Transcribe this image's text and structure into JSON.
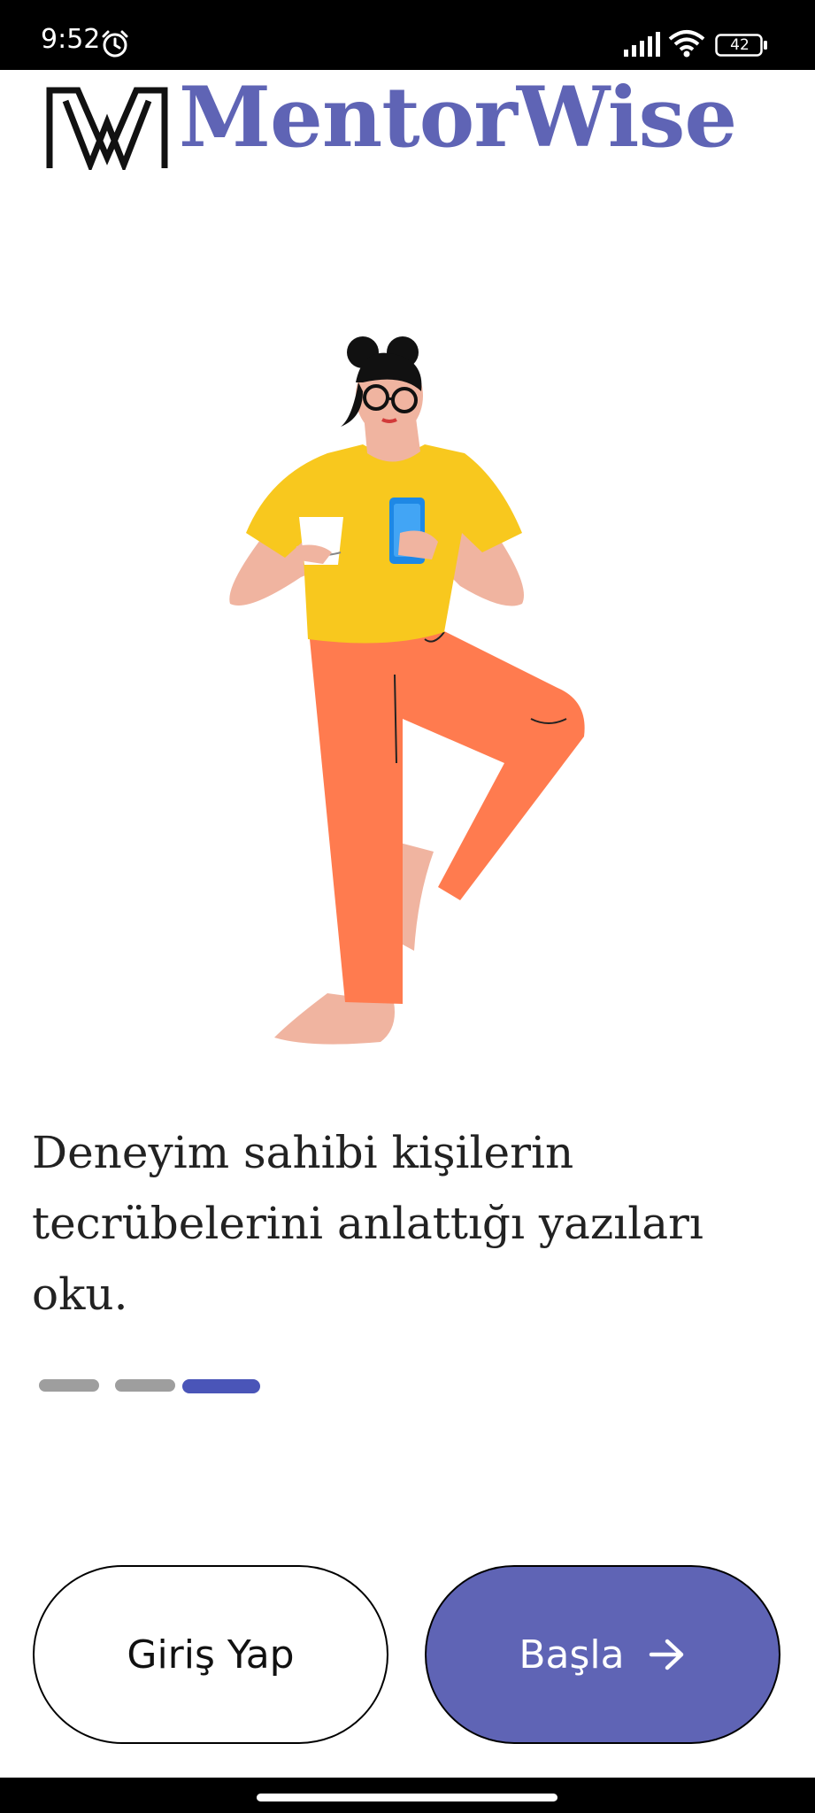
{
  "status_bar": {
    "time": "9:52",
    "battery_level": "42",
    "icons": [
      "alarm-icon",
      "signal-icon",
      "wifi-icon",
      "battery-icon"
    ]
  },
  "brand": {
    "name": "MentorWise",
    "logo_icon": "mentorwise-logo-icon",
    "color": "#5f64b5"
  },
  "illustration": {
    "icon": "woman-reading-phone-illustration"
  },
  "onboarding": {
    "line1": "Deneyim sahibi kişilerin",
    "line2": "tecrübelerini anlattığı yazıları oku."
  },
  "pager": {
    "total": 3,
    "active_index": 3,
    "active_color": "#4a55b8",
    "inactive_color": "#9e9e9e"
  },
  "buttons": {
    "login_label": "Giriş Yap",
    "start_label": "Başla",
    "start_icon": "arrow-right-icon"
  }
}
